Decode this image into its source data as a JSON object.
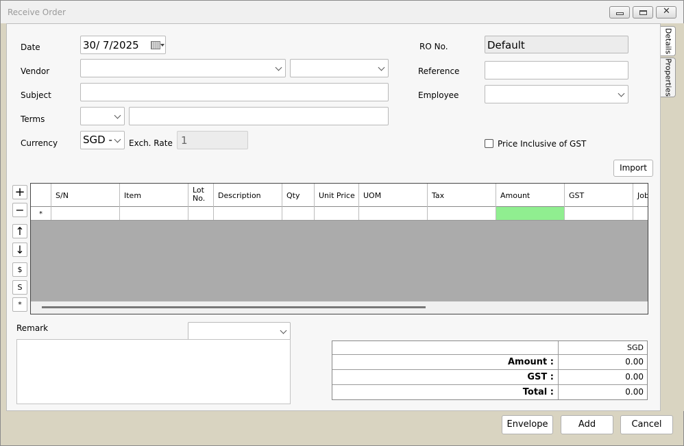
{
  "window": {
    "title": "Receive Order",
    "buttons": [
      "minimize",
      "maximize",
      "close"
    ]
  },
  "side_tabs": [
    "Details",
    "Properties"
  ],
  "form": {
    "date_label": "Date",
    "date_value": "30/  7/2025",
    "vendor_label": "Vendor",
    "subject_label": "Subject",
    "terms_label": "Terms",
    "currency_label": "Currency",
    "currency_value": "SGD -",
    "exch_rate_label": "Exch. Rate",
    "exch_rate_value": "1",
    "ro_no_label": "RO No.",
    "ro_no_value": "Default",
    "reference_label": "Reference",
    "employee_label": "Employee",
    "price_inclusive_label": "Price Inclusive of GST",
    "price_inclusive_checked": false
  },
  "import_button": "Import",
  "grid_side_buttons": [
    "+",
    "−",
    "↑",
    "↓",
    "$",
    "S",
    "*"
  ],
  "grid": {
    "columns": [
      "S/N",
      "Item",
      "Lot\nNo.",
      "Description",
      "Qty",
      "Unit Price",
      "UOM",
      "Tax",
      "Amount",
      "GST",
      "Job"
    ],
    "new_row_marker": "*",
    "highlight_color": "#90ee90"
  },
  "remark": {
    "label": "Remark"
  },
  "totals": {
    "currency_header": "SGD",
    "amount_label": "Amount :",
    "amount_value": "0.00",
    "gst_label": "GST :",
    "gst_value": "0.00",
    "total_label": "Total :",
    "total_value": "0.00"
  },
  "footer": {
    "envelope": "Envelope",
    "add": "Add",
    "cancel": "Cancel"
  }
}
